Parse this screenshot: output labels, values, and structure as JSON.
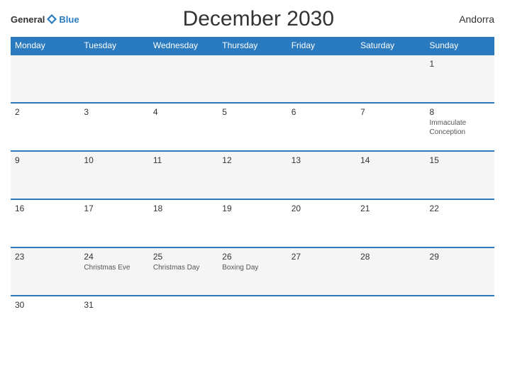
{
  "header": {
    "logo_general": "General",
    "logo_blue": "Blue",
    "title": "December 2030",
    "region": "Andorra"
  },
  "days_of_week": [
    "Monday",
    "Tuesday",
    "Wednesday",
    "Thursday",
    "Friday",
    "Saturday",
    "Sunday"
  ],
  "weeks": [
    [
      {
        "day": "",
        "holiday": ""
      },
      {
        "day": "",
        "holiday": ""
      },
      {
        "day": "",
        "holiday": ""
      },
      {
        "day": "",
        "holiday": ""
      },
      {
        "day": "",
        "holiday": ""
      },
      {
        "day": "",
        "holiday": ""
      },
      {
        "day": "1",
        "holiday": ""
      }
    ],
    [
      {
        "day": "2",
        "holiday": ""
      },
      {
        "day": "3",
        "holiday": ""
      },
      {
        "day": "4",
        "holiday": ""
      },
      {
        "day": "5",
        "holiday": ""
      },
      {
        "day": "6",
        "holiday": ""
      },
      {
        "day": "7",
        "holiday": ""
      },
      {
        "day": "8",
        "holiday": "Immaculate Conception"
      }
    ],
    [
      {
        "day": "9",
        "holiday": ""
      },
      {
        "day": "10",
        "holiday": ""
      },
      {
        "day": "11",
        "holiday": ""
      },
      {
        "day": "12",
        "holiday": ""
      },
      {
        "day": "13",
        "holiday": ""
      },
      {
        "day": "14",
        "holiday": ""
      },
      {
        "day": "15",
        "holiday": ""
      }
    ],
    [
      {
        "day": "16",
        "holiday": ""
      },
      {
        "day": "17",
        "holiday": ""
      },
      {
        "day": "18",
        "holiday": ""
      },
      {
        "day": "19",
        "holiday": ""
      },
      {
        "day": "20",
        "holiday": ""
      },
      {
        "day": "21",
        "holiday": ""
      },
      {
        "day": "22",
        "holiday": ""
      }
    ],
    [
      {
        "day": "23",
        "holiday": ""
      },
      {
        "day": "24",
        "holiday": "Christmas Eve"
      },
      {
        "day": "25",
        "holiday": "Christmas Day"
      },
      {
        "day": "26",
        "holiday": "Boxing Day"
      },
      {
        "day": "27",
        "holiday": ""
      },
      {
        "day": "28",
        "holiday": ""
      },
      {
        "day": "29",
        "holiday": ""
      }
    ],
    [
      {
        "day": "30",
        "holiday": ""
      },
      {
        "day": "31",
        "holiday": ""
      },
      {
        "day": "",
        "holiday": ""
      },
      {
        "day": "",
        "holiday": ""
      },
      {
        "day": "",
        "holiday": ""
      },
      {
        "day": "",
        "holiday": ""
      },
      {
        "day": "",
        "holiday": ""
      }
    ]
  ]
}
